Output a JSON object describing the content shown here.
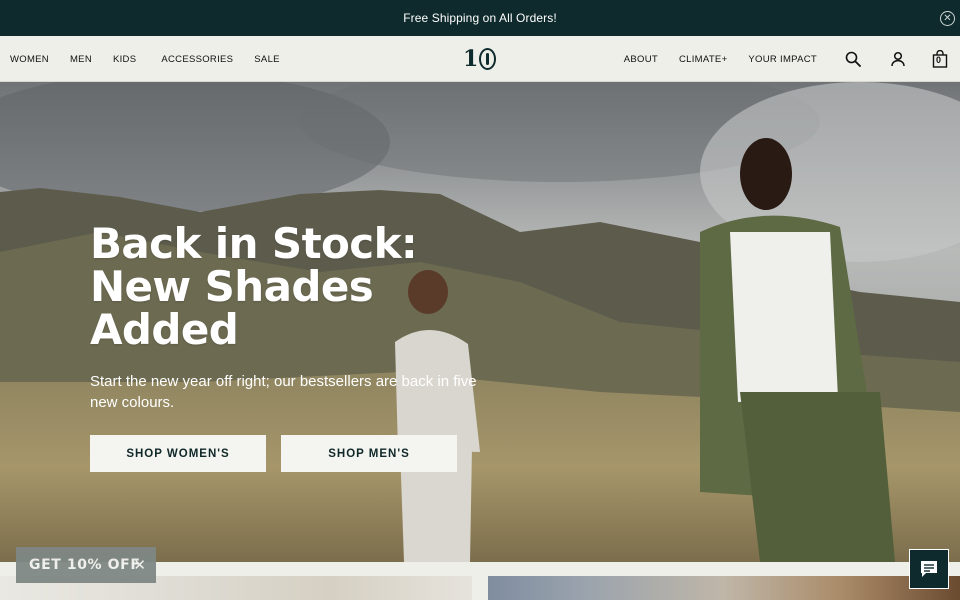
{
  "announcement": {
    "text": "Free Shipping on All Orders!"
  },
  "nav": {
    "left": [
      "WOMEN",
      "MEN",
      "KIDS",
      "ACCESSORIES",
      "SALE"
    ],
    "right": [
      "ABOUT",
      "CLIMATE+",
      "YOUR IMPACT"
    ],
    "cart_count": "0"
  },
  "hero": {
    "title": "Back in Stock: New Shades Added",
    "subtitle": "Start the new year off right; our bestsellers are back in five new colours.",
    "buttons": [
      "SHOP WOMEN'S",
      "SHOP MEN'S"
    ]
  },
  "promo": {
    "label": "GET 10% OFF"
  },
  "icons": {
    "search": "search-icon",
    "account": "user-icon",
    "cart": "shopping-bag-icon",
    "close": "close-icon",
    "chat": "chat-icon"
  }
}
